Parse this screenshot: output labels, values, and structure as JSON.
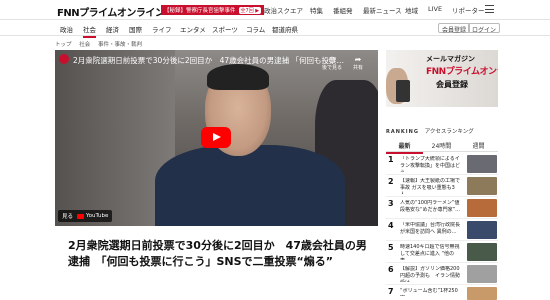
{
  "header": {
    "logo": "FNNプライムオンライン",
    "promo_text": "【秘録】警察庁長官狙撃事件",
    "promo_tag": "全7回 ▶",
    "nav": [
      "政治スクエア",
      "特集",
      "番組発",
      "最新ニュース",
      "地域",
      "LIVE",
      "リポーター"
    ]
  },
  "categories": {
    "items": [
      "政治",
      "社会",
      "経済",
      "国際",
      "ライフ",
      "エンタメ",
      "スポーツ",
      "コラム",
      "都道府県"
    ],
    "active": "社会",
    "login_buttons": [
      "会員登録",
      "ログイン"
    ]
  },
  "breadcrumb": [
    "トップ",
    "社会",
    "事件・事故・裁判"
  ],
  "player": {
    "title": "2月衆院選期日前投票で30分後に2回目か　47歳会社員の男逮捕 「何回も投票…",
    "later_label": "後で見る",
    "share_label": "共有",
    "watch_on": "見る",
    "youtube": "YouTube",
    "brand_color": "#ff0000"
  },
  "article": {
    "title": "2月衆院選期日前投票で30分後に2回目か　47歳会社員の男逮捕　「何回も投票に行こう」SNSで二重投票“煽る”"
  },
  "banner": {
    "line1": "メールマガジン",
    "line2": "FNNプライムオンラインplus",
    "line3": "会員登録"
  },
  "ranking": {
    "label": "アクセスランキング",
    "tag": "RANKING",
    "tabs": [
      "最新",
      "24時間",
      "週間"
    ],
    "active_tab": "最新",
    "items": [
      {
        "rank": "1",
        "text": "「トランプ大統領によるイラン攻撃転換」を中国はどう…",
        "thumb_color": "#6a6a72"
      },
      {
        "rank": "2",
        "text": "【速報】大王製紙の工場で事故 ガスを吸い重態も3人…",
        "thumb_color": "#8c7a5a"
      },
      {
        "rank": "3",
        "text": "人気の“100円ラーメン”値段格安な“めだか専門家”…",
        "thumb_color": "#b86b3a"
      },
      {
        "rank": "4",
        "text": "「米中協議」台湾行政院長が米国を訪問へ 異例の…",
        "thumb_color": "#3a4a6a"
      },
      {
        "rank": "5",
        "text": "時速140キロ超で信号無視して交差点に進入 “他の車…",
        "thumb_color": "#4a5a4a"
      },
      {
        "rank": "6",
        "text": "【解説】ガソリン価格200円超の予測も　イラン情勢受け…",
        "thumb_color": "#a0a0a0"
      },
      {
        "rank": "7",
        "text": "“ボリューム含む”1杯250円…",
        "thumb_color": "#c89a6a"
      }
    ]
  }
}
